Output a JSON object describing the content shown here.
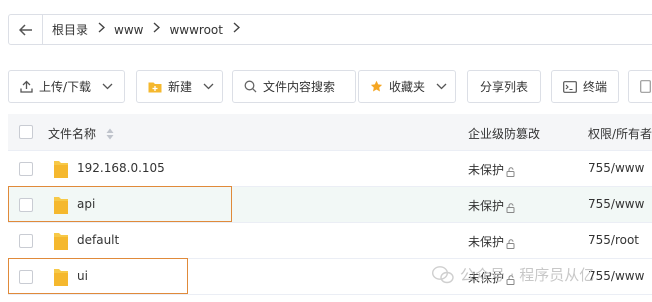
{
  "breadcrumb": {
    "items": [
      "根目录",
      "www",
      "wwwroot"
    ]
  },
  "toolbar": {
    "upload_download": "上传/下载",
    "new": "新建",
    "content_search": "文件内容搜索",
    "favorites": "收藏夹",
    "share_list": "分享列表",
    "terminal": "终端"
  },
  "table": {
    "headers": {
      "name": "文件名称",
      "protection": "企业级防篡改",
      "permission": "权限/所有者"
    },
    "rows": [
      {
        "name": "192.168.0.105",
        "protection": "未保护",
        "permission": "755/www"
      },
      {
        "name": "api",
        "protection": "未保护",
        "permission": "755/www"
      },
      {
        "name": "default",
        "protection": "未保护",
        "permission": "755/root"
      },
      {
        "name": "ui",
        "protection": "未保护",
        "permission": "755/www"
      }
    ]
  },
  "watermark": {
    "text": "公众号 · 程序员从亿"
  },
  "colors": {
    "highlight_border": "#e08a3a",
    "folder": "#f7c948",
    "hover_row": "#f2f8f6",
    "header_bg": "#f5f6f8"
  }
}
